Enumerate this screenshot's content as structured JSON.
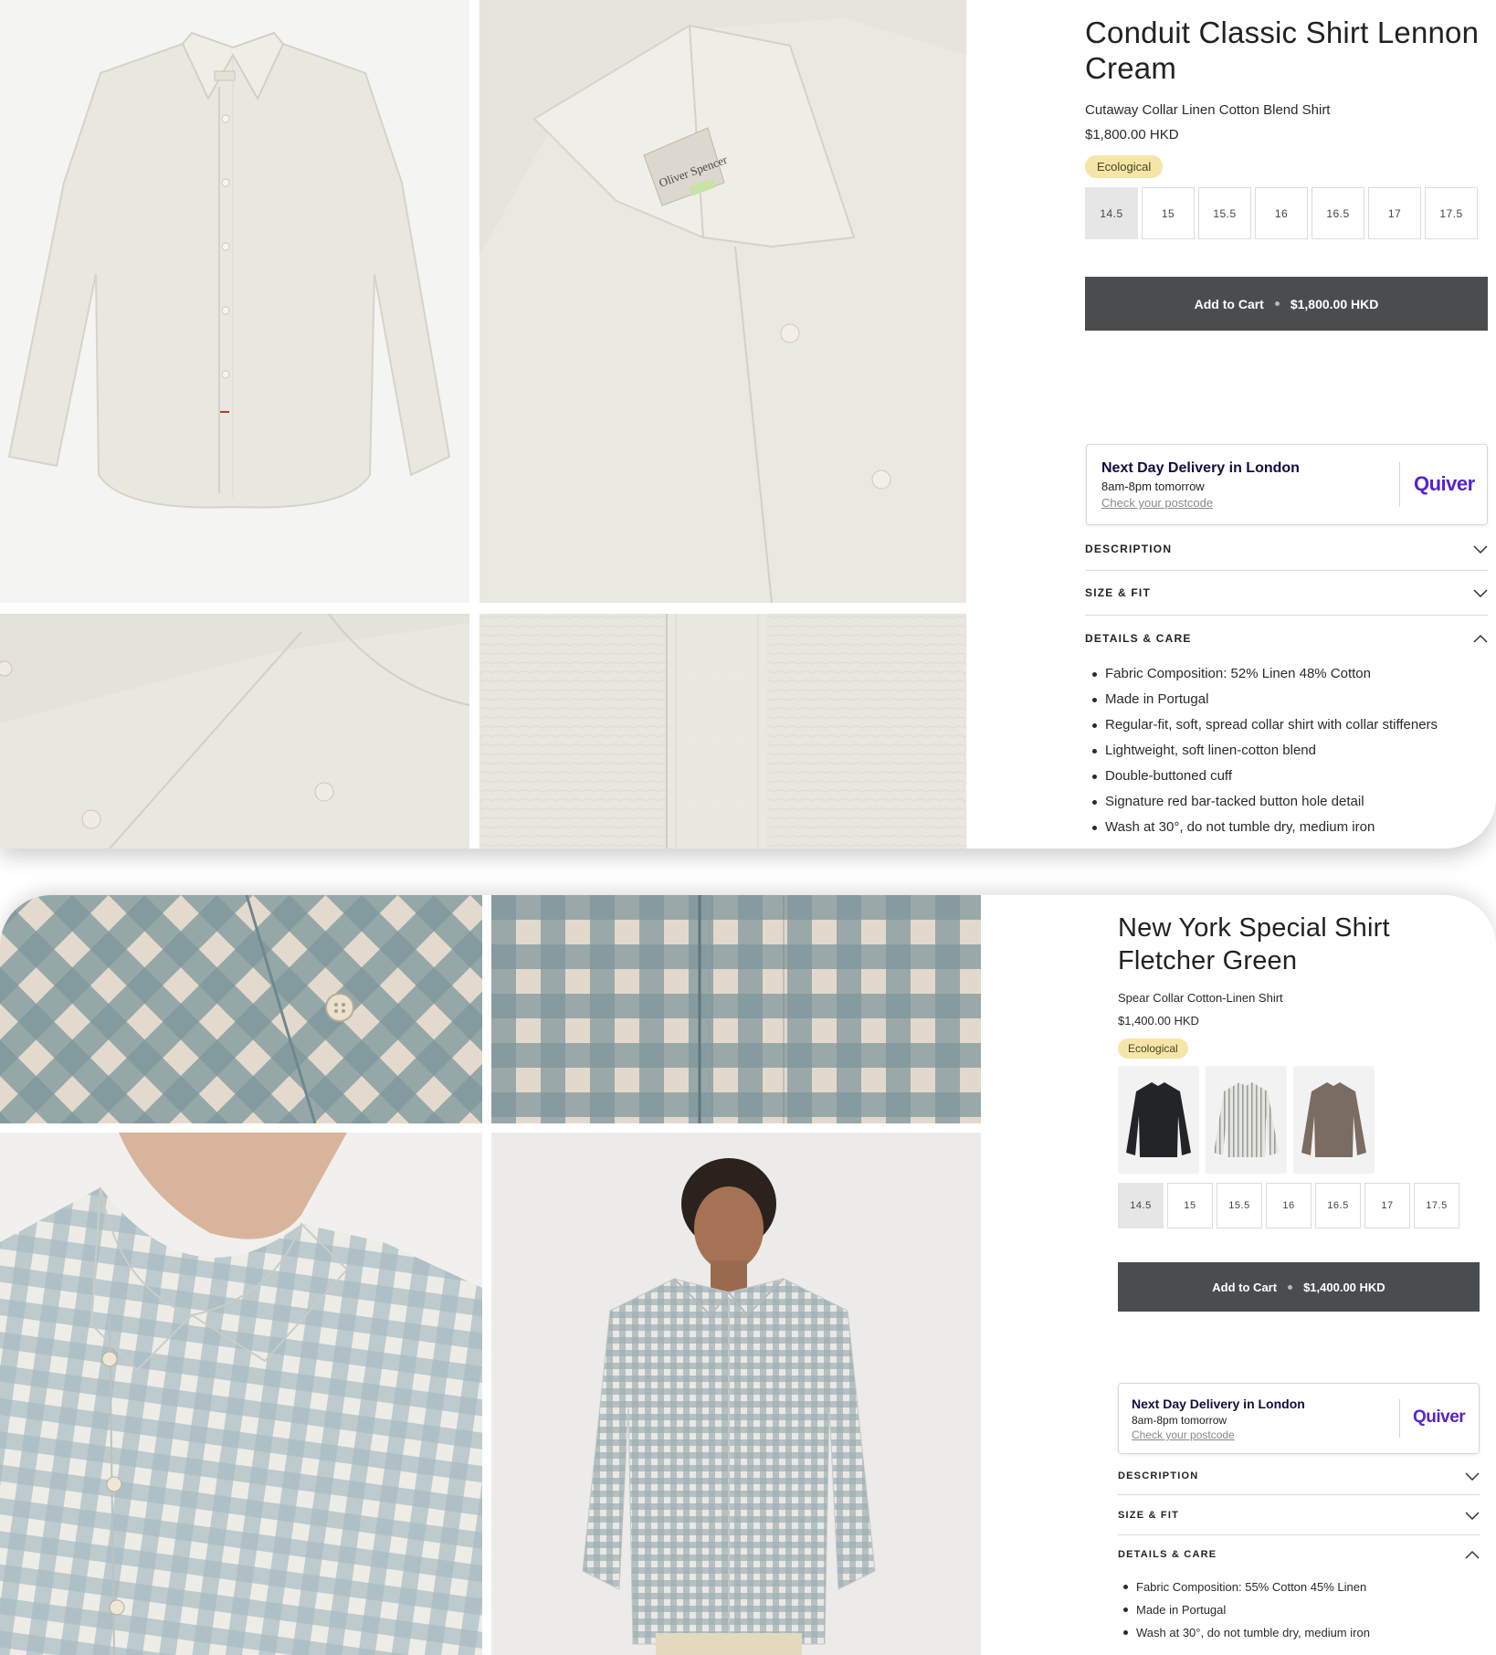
{
  "products": [
    {
      "title_line1": "Conduit Classic Shirt Lennon",
      "title_line2": "Cream",
      "subtitle": "Cutaway Collar Linen Cotton Blend Shirt",
      "price": "$1,800.00 HKD",
      "badge": "Ecological",
      "sizes": [
        "14.5",
        "15",
        "15.5",
        "16",
        "16.5",
        "17",
        "17.5"
      ],
      "selected_size": "14.5",
      "cart_label": "Add to Cart",
      "cart_price": "$1,800.00 HKD",
      "delivery": {
        "title": "Next Day Delivery in London",
        "time": "8am-8pm tomorrow",
        "link": "Check your postcode",
        "logo": "Quiver"
      },
      "accordions": {
        "description": "DESCRIPTION",
        "size_fit": "SIZE & FIT",
        "details": "DETAILS & CARE"
      },
      "details": [
        "Fabric Composition: 52% Linen 48% Cotton",
        "Made in Portugal",
        "Regular-fit, soft, spread collar shirt with collar stiffeners",
        "Lightweight, soft linen-cotton blend",
        "Double-buttoned cuff",
        "Signature red bar-tacked button hole detail",
        "Wash at 30°, do not tumble dry, medium iron"
      ],
      "images": [
        "cream-shirt-front-image",
        "cream-shirt-collar-image",
        "cream-shirt-cuff-image",
        "cream-shirt-fabric-image"
      ],
      "label_text": "Oliver Spencer",
      "colors": {
        "fabric": "#ecebe3",
        "cart": "#4a4d50",
        "badge": "#f5e6a8",
        "logo": "#5624c9"
      }
    },
    {
      "title_line1": "New York Special Shirt",
      "title_line2": "Fletcher Green",
      "subtitle": "Spear Collar Cotton-Linen Shirt",
      "price": "$1,400.00 HKD",
      "badge": "Ecological",
      "swatches": [
        "black-shirt-swatch",
        "striped-shirt-swatch",
        "brown-shirt-swatch"
      ],
      "sizes": [
        "14.5",
        "15",
        "15.5",
        "16",
        "16.5",
        "17",
        "17.5"
      ],
      "selected_size": "14.5",
      "cart_label": "Add to Cart",
      "cart_price": "$1,400.00 HKD",
      "delivery": {
        "title": "Next Day Delivery in London",
        "time": "8am-8pm tomorrow",
        "link": "Check your postcode",
        "logo": "Quiver"
      },
      "accordions": {
        "description": "DESCRIPTION",
        "size_fit": "SIZE & FIT",
        "details": "DETAILS & CARE"
      },
      "details": [
        "Fabric Composition: 55% Cotton 45% Linen",
        "Made in Portugal",
        "Wash at 30°, do not tumble dry, medium iron"
      ],
      "images": [
        "gingham-button-closeup-image",
        "gingham-placket-image",
        "gingham-collar-model-image",
        "gingham-model-full-image"
      ],
      "colors": {
        "gingham": "#7c959c",
        "cream": "#e6ddd0"
      }
    }
  ]
}
